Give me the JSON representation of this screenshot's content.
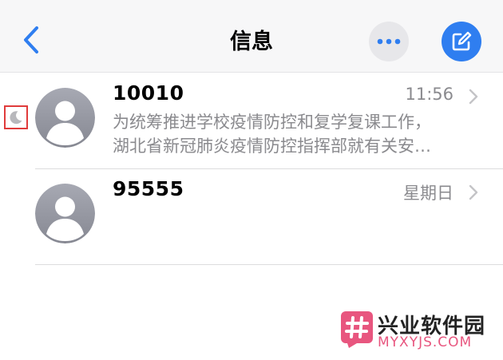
{
  "header": {
    "title": "信息",
    "back_icon": "chevron-left-icon",
    "more_icon": "ellipsis-icon",
    "compose_icon": "compose-icon"
  },
  "conversations": [
    {
      "sender": "10010",
      "time": "11:56",
      "preview_line1": "为统筹推进学校疫情防控和复学复课工作，",
      "preview_line2": "湖北省新冠肺炎疫情防控指挥部就有关安…",
      "muted": true,
      "muted_icon": "moon-icon"
    },
    {
      "sender": "95555",
      "time": "星期日",
      "preview_line1": "",
      "preview_line2": "",
      "muted": false
    }
  ],
  "watermark": {
    "name": "兴业软件园",
    "domain": "MYXYJS.COM"
  },
  "colors": {
    "accent": "#2f7ef0",
    "highlight_box": "#e03b3b",
    "watermark_pink": "#e8567f",
    "secondary_text": "#8a8a8e"
  }
}
